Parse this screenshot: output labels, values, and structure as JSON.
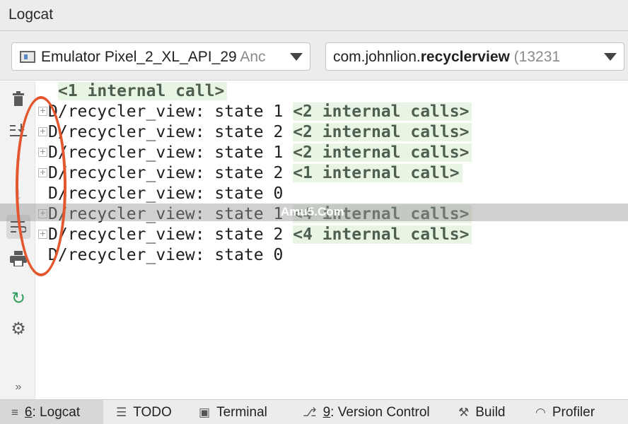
{
  "window": {
    "title": "Logcat"
  },
  "selectors": {
    "device": {
      "label": "Emulator Pixel_2_XL_API_29",
      "suffix": "Anc"
    },
    "process": {
      "prefix": "com.johnlion.",
      "bold": "recyclerview",
      "suffix": " (13231"
    }
  },
  "toolbar": {
    "icons": [
      "trash-icon",
      "scroll-to-end-icon",
      "up-arrow-icon",
      "down-arrow-icon",
      "soft-wrap-icon",
      "print-icon",
      "restart-icon",
      "gear-icon",
      "more-icon"
    ]
  },
  "log": {
    "partial_fold": "<1 internal call>",
    "lines": [
      {
        "prefix": "D/recycler_view: state 1 ",
        "fold": "<2 internal calls>",
        "expandable": true
      },
      {
        "prefix": "D/recycler_view: state 2 ",
        "fold": "<2 internal calls>",
        "expandable": true
      },
      {
        "prefix": "D/recycler_view: state 1 ",
        "fold": "<2 internal calls>",
        "expandable": true
      },
      {
        "prefix": "D/recycler_view: state 2 ",
        "fold": "<1 internal call>",
        "expandable": true
      },
      {
        "prefix": "D/recycler_view: state 0",
        "fold": "",
        "expandable": false
      },
      {
        "prefix": "D/recycler_view: state 1 ",
        "fold": "<4 internal calls>",
        "expandable": true
      },
      {
        "prefix": "D/recycler_view: state 2 ",
        "fold": "<4 internal calls>",
        "expandable": true
      },
      {
        "prefix": "D/recycler_view: state 0",
        "fold": "",
        "expandable": false
      }
    ],
    "watermark": "Amu5.Com"
  },
  "bottom_tabs": [
    {
      "mnemonic": "6",
      "label": ": Logcat",
      "icon": "logcat-icon",
      "active": true
    },
    {
      "mnemonic": "",
      "label": "TODO",
      "icon": "todo-icon",
      "active": false
    },
    {
      "mnemonic": "",
      "label": "Terminal",
      "icon": "terminal-icon",
      "active": false
    },
    {
      "mnemonic": "9",
      "label": ": Version Control",
      "icon": "vcs-icon",
      "active": false
    },
    {
      "mnemonic": "",
      "label": "Build",
      "icon": "hammer-icon",
      "active": false
    },
    {
      "mnemonic": "",
      "label": "Profiler",
      "icon": "gauge-icon",
      "active": false
    }
  ],
  "colors": {
    "annotation": "#e4572e",
    "fold_bg": "#e9f5e4"
  }
}
